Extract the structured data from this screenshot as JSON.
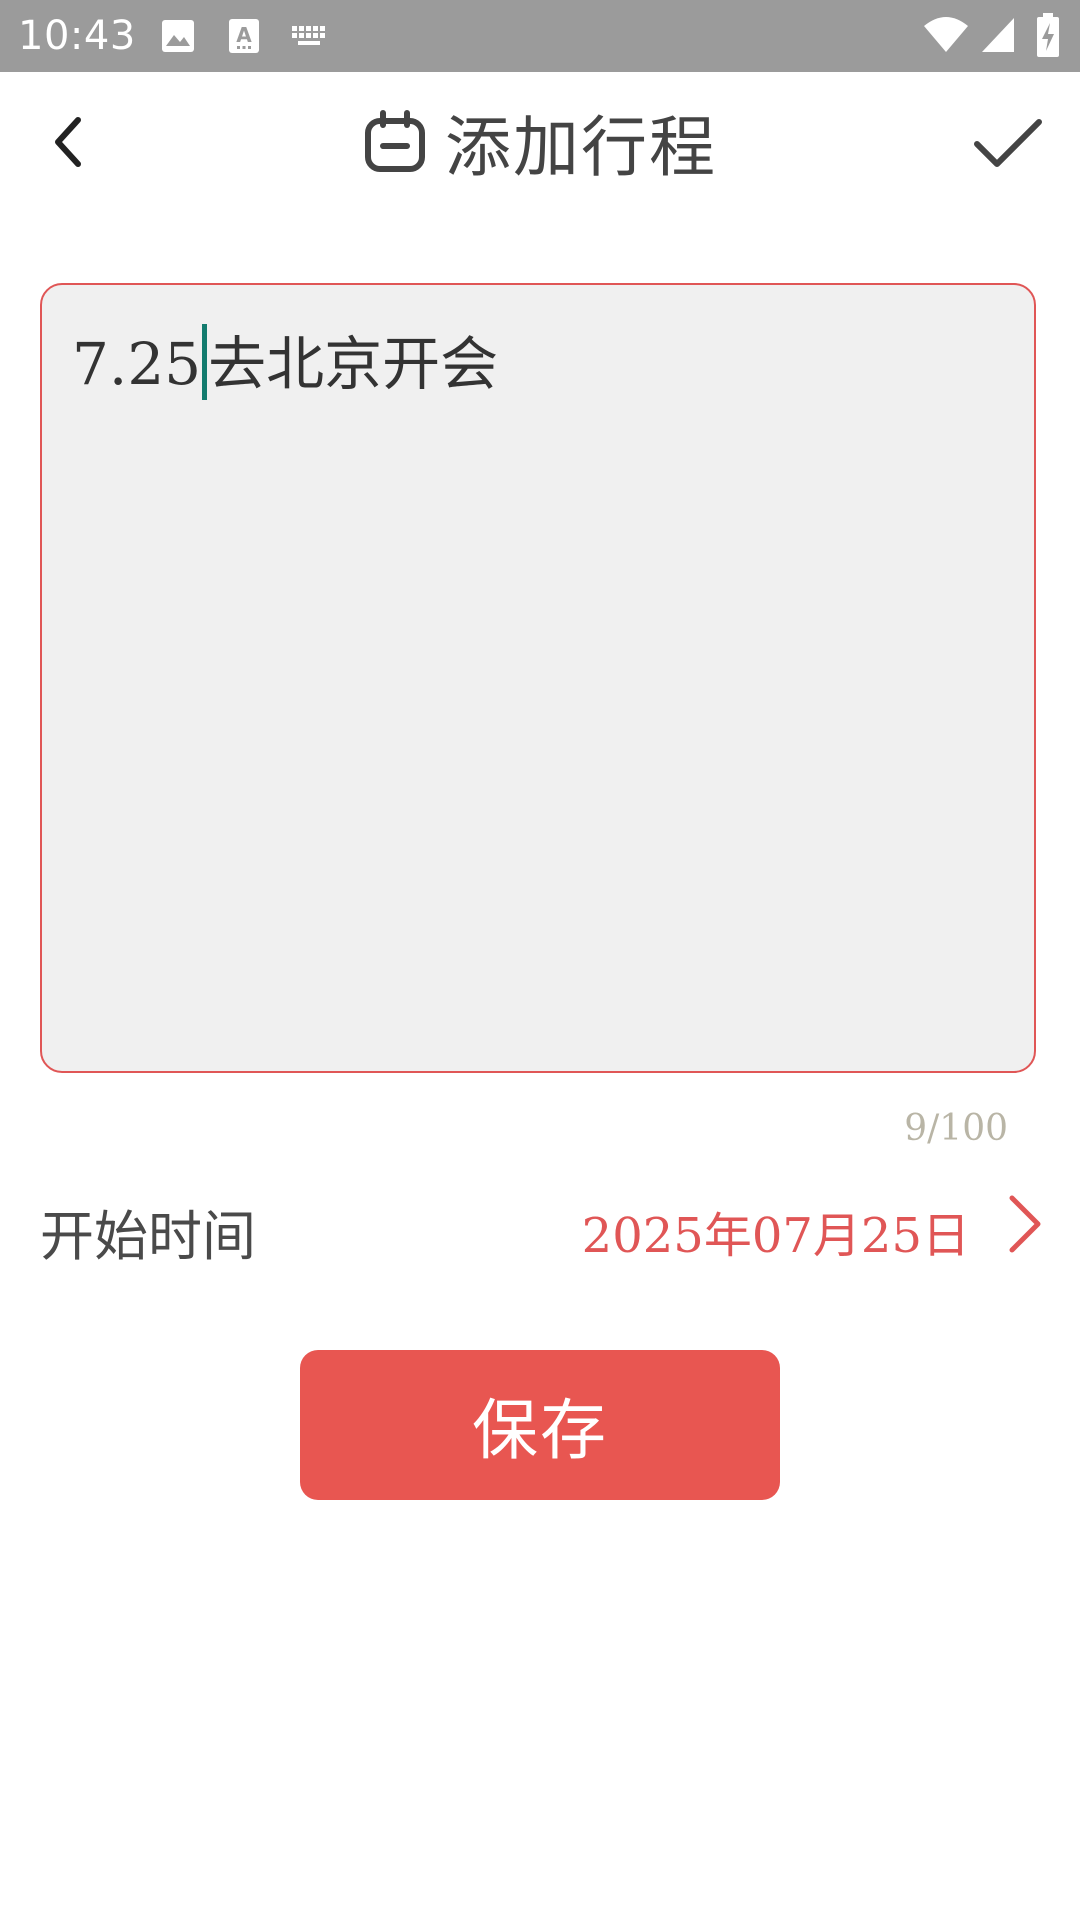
{
  "status_bar": {
    "time": "10:43",
    "left_icons": [
      "image-icon",
      "text-a-icon",
      "keyboard-icon"
    ],
    "right_icons": [
      "wifi-icon",
      "cell-signal-icon",
      "battery-charging-icon"
    ]
  },
  "header": {
    "title": "添加行程",
    "title_icon": "calendar-icon",
    "back_icon": "chevron-left-icon",
    "confirm_icon": "checkmark-icon"
  },
  "editor": {
    "text_before_caret": "7.25",
    "text_after_caret": "去北京开会",
    "counter": "9/100"
  },
  "start_time": {
    "label": "开始时间",
    "value": "2025年07月25日"
  },
  "save_button": {
    "label": "保存"
  },
  "colors": {
    "accent": "#e85651",
    "status_bar": "#9b9b9b",
    "editor_bg": "#f0f0f0",
    "caret": "#137b6e"
  }
}
